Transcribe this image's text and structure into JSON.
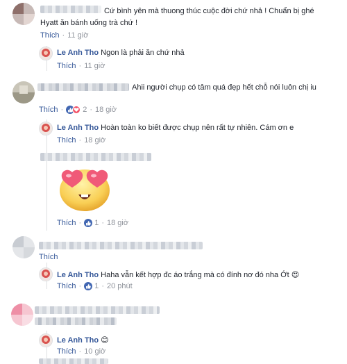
{
  "colors": {
    "link": "#365899",
    "meta": "#90949c",
    "text": "#1d2129",
    "like_reaction": "#4267b2",
    "love_reaction": "#f25268"
  },
  "comments": [
    {
      "text": "Cứ bình yên mà thuong thúc cuộc đời chứ nhả ! Chuẩn bị ghé Hyatt ăn bánh uống trà chứ !",
      "actions": {
        "like": "Thích",
        "time": "11 giờ"
      }
    },
    {
      "text": "Ahii người chụp có tâm quá đẹp hết chỗ nói luôn chị iu",
      "actions": {
        "like": "Thích",
        "reaction_count": "2",
        "time": "18 giờ"
      }
    },
    {
      "actions": {
        "like": "Thích",
        "reaction_count": "1",
        "time": "18 giờ"
      }
    },
    {
      "actions": {
        "like": "Thích"
      }
    },
    {
      "actions": {}
    }
  ],
  "replies": [
    {
      "name": "Le Anh Tho",
      "text": "Ngon là phải ăn chứ nhả",
      "like": "Thích",
      "time": "11 giờ"
    },
    {
      "name": "Le Anh Tho",
      "text": "Hoàn toàn ko biết được chụp nên rất tự nhiên. Cám ơn e",
      "like": "Thích",
      "time": "18 giờ"
    },
    {
      "name": "Le Anh Tho",
      "text": "Haha vẫn kết hợp đc áo trắng mà có đính nơ đó nha Ớt",
      "emoji": "😍",
      "like": "Thích",
      "reaction_count": "1",
      "time": "20 phút"
    },
    {
      "name": "Le Anh Tho",
      "emoji": "😊",
      "like": "Thích",
      "time": "10 giờ"
    }
  ]
}
